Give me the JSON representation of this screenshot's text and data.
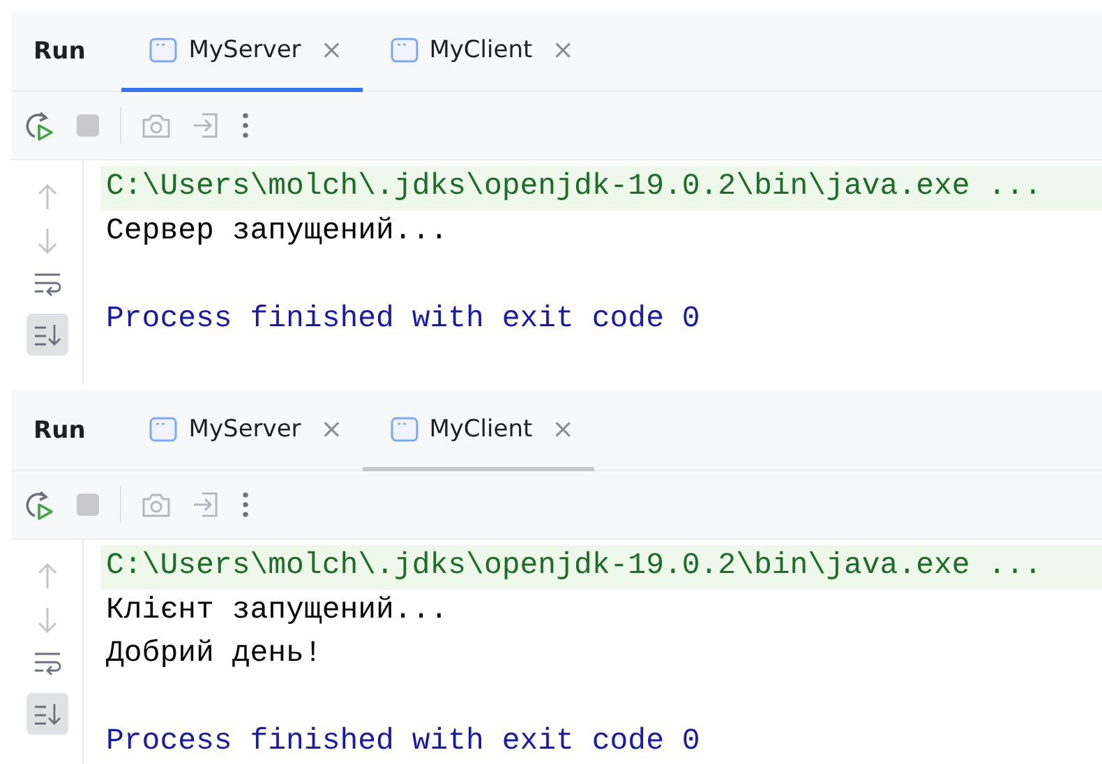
{
  "panels": [
    {
      "focused": true,
      "title": "Run",
      "tabs": [
        {
          "label": "MyServer",
          "selected": true,
          "close": "×"
        },
        {
          "label": "MyClient",
          "selected": false,
          "close": "×"
        }
      ],
      "scroll_to_end": true,
      "lines": [
        {
          "kind": "command",
          "text": "C:\\Users\\molch\\.jdks\\openjdk-19.0.2\\bin\\java.exe ..."
        },
        {
          "kind": "output",
          "text": "Сервер запущений..."
        },
        {
          "kind": "blank"
        },
        {
          "kind": "exit",
          "text": "Process finished with exit code 0"
        }
      ]
    },
    {
      "focused": false,
      "title": "Run",
      "tabs": [
        {
          "label": "MyServer",
          "selected": false,
          "close": "×"
        },
        {
          "label": "MyClient",
          "selected": true,
          "close": "×"
        }
      ],
      "scroll_to_end": true,
      "lines": [
        {
          "kind": "command",
          "text": "C:\\Users\\molch\\.jdks\\openjdk-19.0.2\\bin\\java.exe ..."
        },
        {
          "kind": "output",
          "text": "Клієнт запущений..."
        },
        {
          "kind": "output",
          "text": "Добрий день!"
        },
        {
          "kind": "blank"
        },
        {
          "kind": "exit",
          "text": "Process finished with exit code 0"
        }
      ]
    }
  ]
}
